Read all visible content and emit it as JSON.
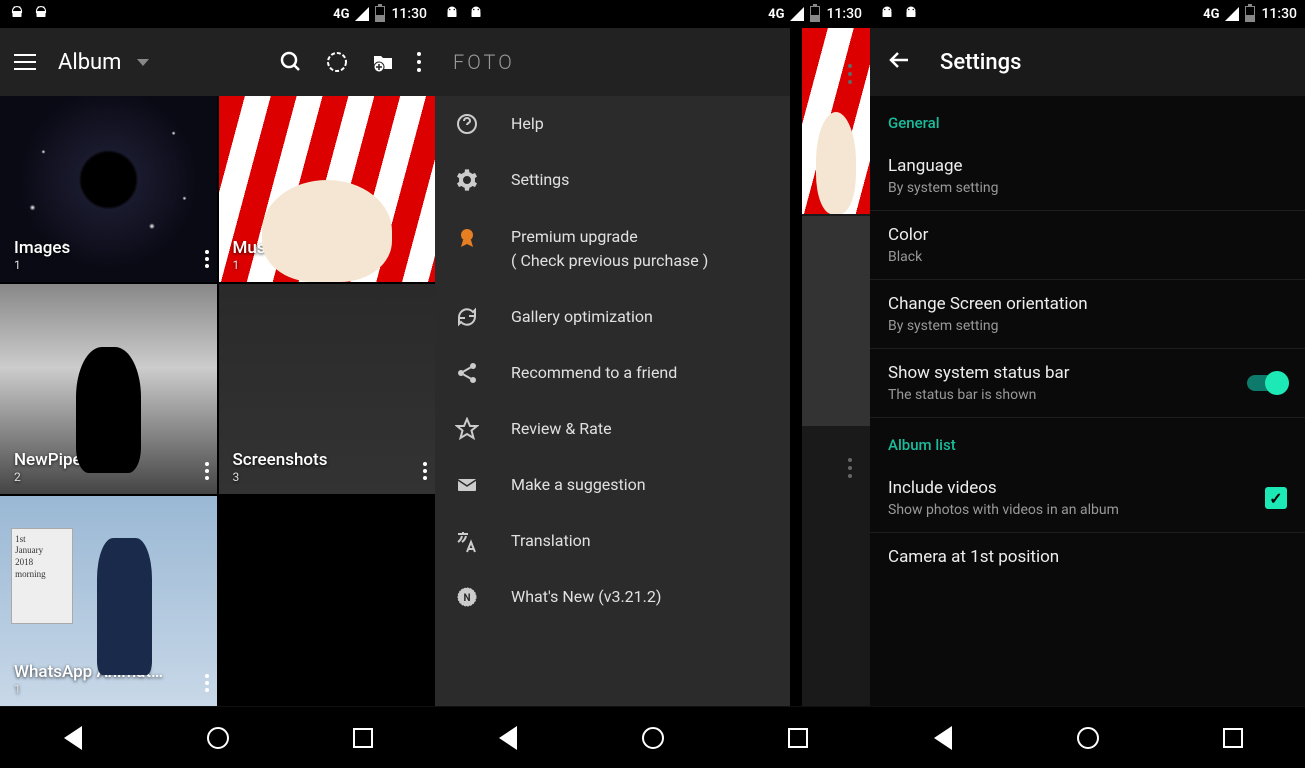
{
  "status": {
    "network": "4G",
    "time": "11:30"
  },
  "screen1": {
    "toolbar_title": "Album",
    "albums": [
      {
        "name": "Images",
        "count": "1"
      },
      {
        "name": "Music",
        "count": "1"
      },
      {
        "name": "NewPipe",
        "count": "2"
      },
      {
        "name": "Screenshots",
        "count": "3"
      },
      {
        "name": "WhatsApp Animat…",
        "count": "1"
      }
    ],
    "wa_sign": "1st\nJanuary\n2018\nmorning"
  },
  "screen2": {
    "logo": "FOTO",
    "items": [
      {
        "label": "Help"
      },
      {
        "label": "Settings"
      },
      {
        "label": "Premium upgrade",
        "sub": "( Check previous purchase )"
      },
      {
        "label": "Gallery optimization"
      },
      {
        "label": "Recommend to a friend"
      },
      {
        "label": "Review & Rate"
      },
      {
        "label": "Make a suggestion"
      },
      {
        "label": "Translation"
      },
      {
        "label": "What's New (v3.21.2)"
      }
    ]
  },
  "screen3": {
    "title": "Settings",
    "section_general": "General",
    "section_album": "Album list",
    "rows": {
      "language": {
        "name": "Language",
        "value": "By system setting"
      },
      "color": {
        "name": "Color",
        "value": "Black"
      },
      "orientation": {
        "name": "Change Screen orientation",
        "value": "By system setting"
      },
      "statusbar": {
        "name": "Show system status bar",
        "value": "The status bar is shown"
      },
      "videos": {
        "name": "Include videos",
        "value": "Show photos with videos in an album"
      },
      "camera": {
        "name": "Camera at 1st position"
      }
    }
  }
}
